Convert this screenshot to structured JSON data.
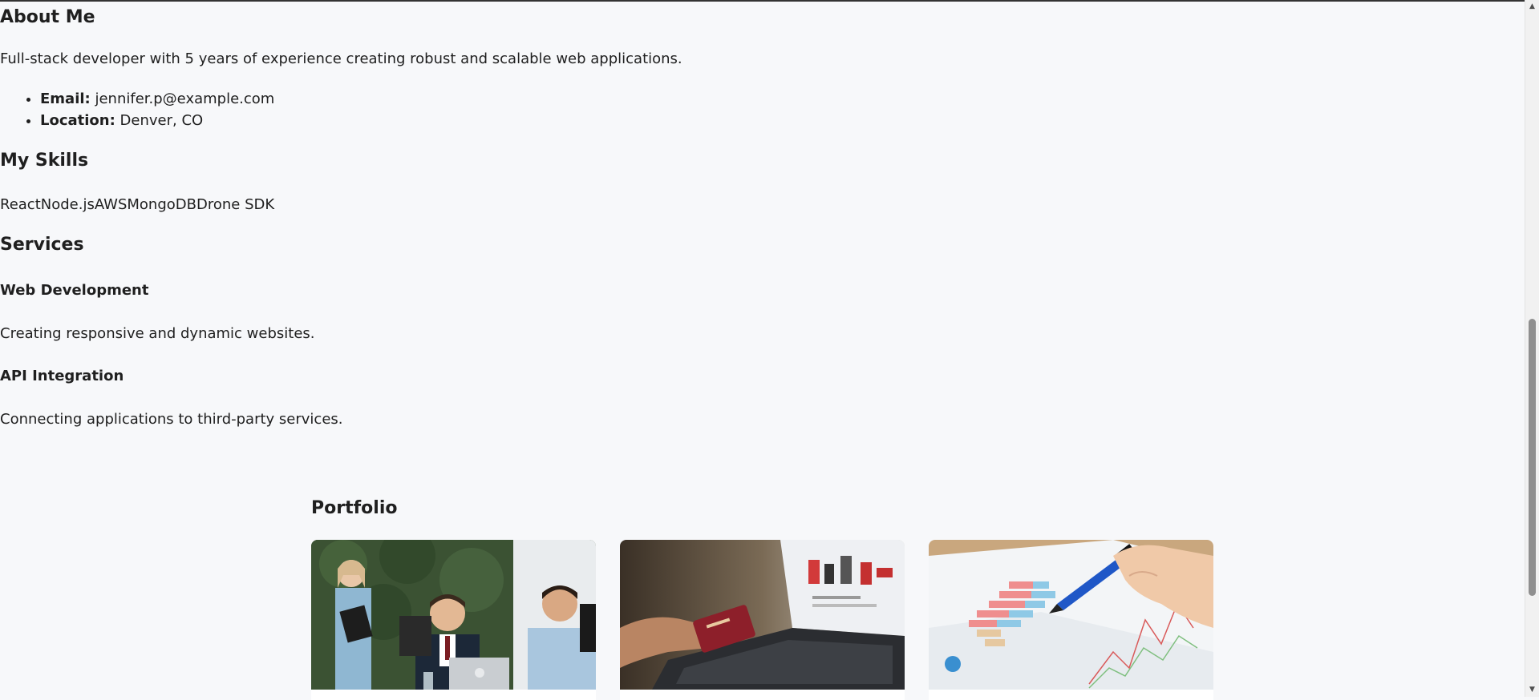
{
  "about": {
    "heading": "About Me",
    "summary": "Full-stack developer with 5 years of experience creating robust and scalable web applications.",
    "email_label": "Email:",
    "email_value": "jennifer.p@example.com",
    "location_label": "Location:",
    "location_value": "Denver, CO"
  },
  "skills": {
    "heading": "My Skills",
    "list_text": "ReactNode.jsAWSMongoDBDrone SDK"
  },
  "services": {
    "heading": "Services",
    "items": [
      {
        "title": "Web Development",
        "description": "Creating responsive and dynamic websites."
      },
      {
        "title": "API Integration",
        "description": "Connecting applications to third-party services."
      }
    ]
  },
  "portfolio": {
    "heading": "Portfolio",
    "cards": [
      {
        "image": "office-meeting-photo"
      },
      {
        "image": "credit-card-laptop-photo"
      },
      {
        "image": "bar-chart-pen-photo"
      }
    ]
  },
  "colors": {
    "background": "#f7f8fa",
    "text": "#1f1f1f"
  }
}
